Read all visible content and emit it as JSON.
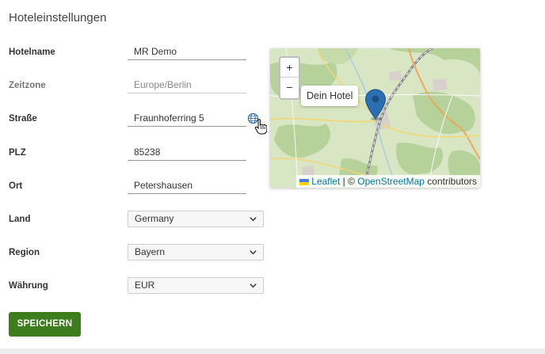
{
  "page": {
    "title": "Hoteleinstellungen"
  },
  "form": {
    "hotelname": {
      "label": "Hotelname",
      "value": "MR Demo"
    },
    "zeitzone": {
      "label": "Zeitzone",
      "value": "Europe/Berlin"
    },
    "strasse": {
      "label": "Straße",
      "value": "Fraunhoferring 5"
    },
    "plz": {
      "label": "PLZ",
      "value": "85238"
    },
    "ort": {
      "label": "Ort",
      "value": "Petershausen"
    },
    "land": {
      "label": "Land",
      "value": "Germany"
    },
    "region": {
      "label": "Region",
      "value": "Bayern"
    },
    "waehrung": {
      "label": "Währung",
      "value": "EUR"
    }
  },
  "map": {
    "zoom_in": "+",
    "zoom_out": "−",
    "popup": "Dein Hotel",
    "attribution": {
      "leaflet": "Leaflet",
      "separator": " | © ",
      "osm": "OpenStreetMap",
      "contributors": " contributors"
    },
    "marker_color": "#2b6fb3"
  },
  "actions": {
    "save": "SPEICHERN"
  },
  "colors": {
    "save_button": "#3d7d1e",
    "link": "#0078a8"
  }
}
